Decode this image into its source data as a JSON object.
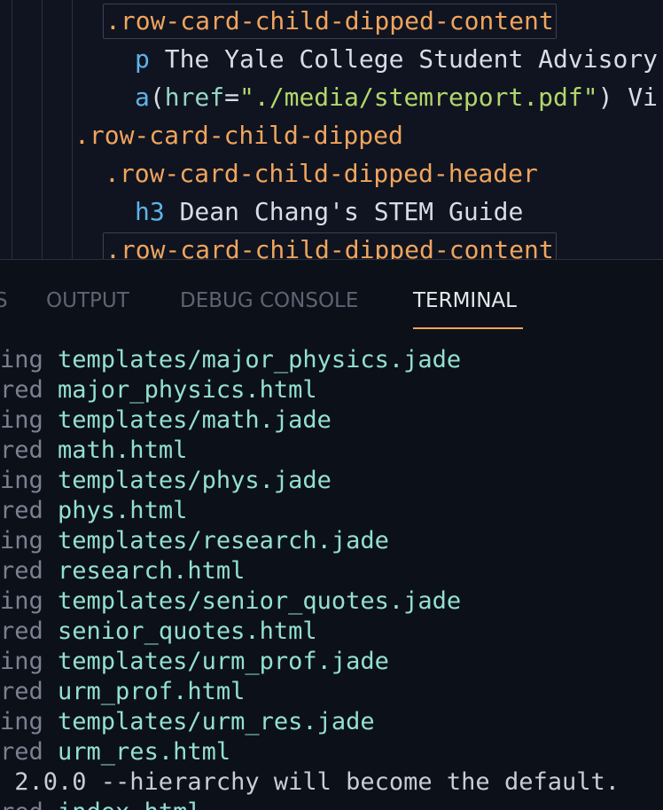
{
  "editor": {
    "lines": [
      {
        "cls": ".row-card-child-dipped-content"
      },
      {
        "tag": "p",
        "text": " The Yale College Student Advisory"
      },
      {
        "tag": "a",
        "paren_open": "(",
        "attr": "href",
        "eq": "=",
        "str": "\"./media/stemreport.pdf\"",
        "paren_close": ")",
        "text": " Vi"
      },
      {
        "cls": ".row-card-child-dipped"
      },
      {
        "cls": ".row-card-child-dipped-header"
      },
      {
        "tag": "h3",
        "text": " Dean Chang's STEM Guide"
      },
      {
        "cls": ".row-card-child-dipped-content"
      }
    ]
  },
  "panel": {
    "tabs": {
      "problems_partial": "S",
      "output": "OUTPUT",
      "debug_console": "DEBUG CONSOLE",
      "terminal": "TERMINAL"
    },
    "active_tab": "TERMINAL"
  },
  "terminal": {
    "lines": [
      {
        "prefix": "ing ",
        "value": "templates/major_physics.jade"
      },
      {
        "prefix": "red ",
        "value": "major_physics.html"
      },
      {
        "prefix": "ing ",
        "value": "templates/math.jade"
      },
      {
        "prefix": "red ",
        "value": "math.html"
      },
      {
        "prefix": "ing ",
        "value": "templates/phys.jade"
      },
      {
        "prefix": "red ",
        "value": "phys.html"
      },
      {
        "prefix": "ing ",
        "value": "templates/research.jade"
      },
      {
        "prefix": "red ",
        "value": "research.html"
      },
      {
        "prefix": "ing ",
        "value": "templates/senior_quotes.jade"
      },
      {
        "prefix": "red ",
        "value": "senior_quotes.html"
      },
      {
        "prefix": "ing ",
        "value": "templates/urm_prof.jade"
      },
      {
        "prefix": "red ",
        "value": "urm_prof.html"
      },
      {
        "prefix": "ing ",
        "value": "templates/urm_res.jade"
      },
      {
        "prefix": "red ",
        "value": "urm_res.html"
      }
    ],
    "message": " 2.0.0 --hierarchy will become the default.",
    "cutoff_line": {
      "prefix": "red ",
      "value": "index.html"
    }
  },
  "colors": {
    "class_selector": "#f0a45d",
    "tag_name": "#5db3e8",
    "attribute": "#97d5c4",
    "string": "#b3d66b",
    "terminal_value": "#93e0cf",
    "active_tab_underline": "#f0a45d"
  }
}
